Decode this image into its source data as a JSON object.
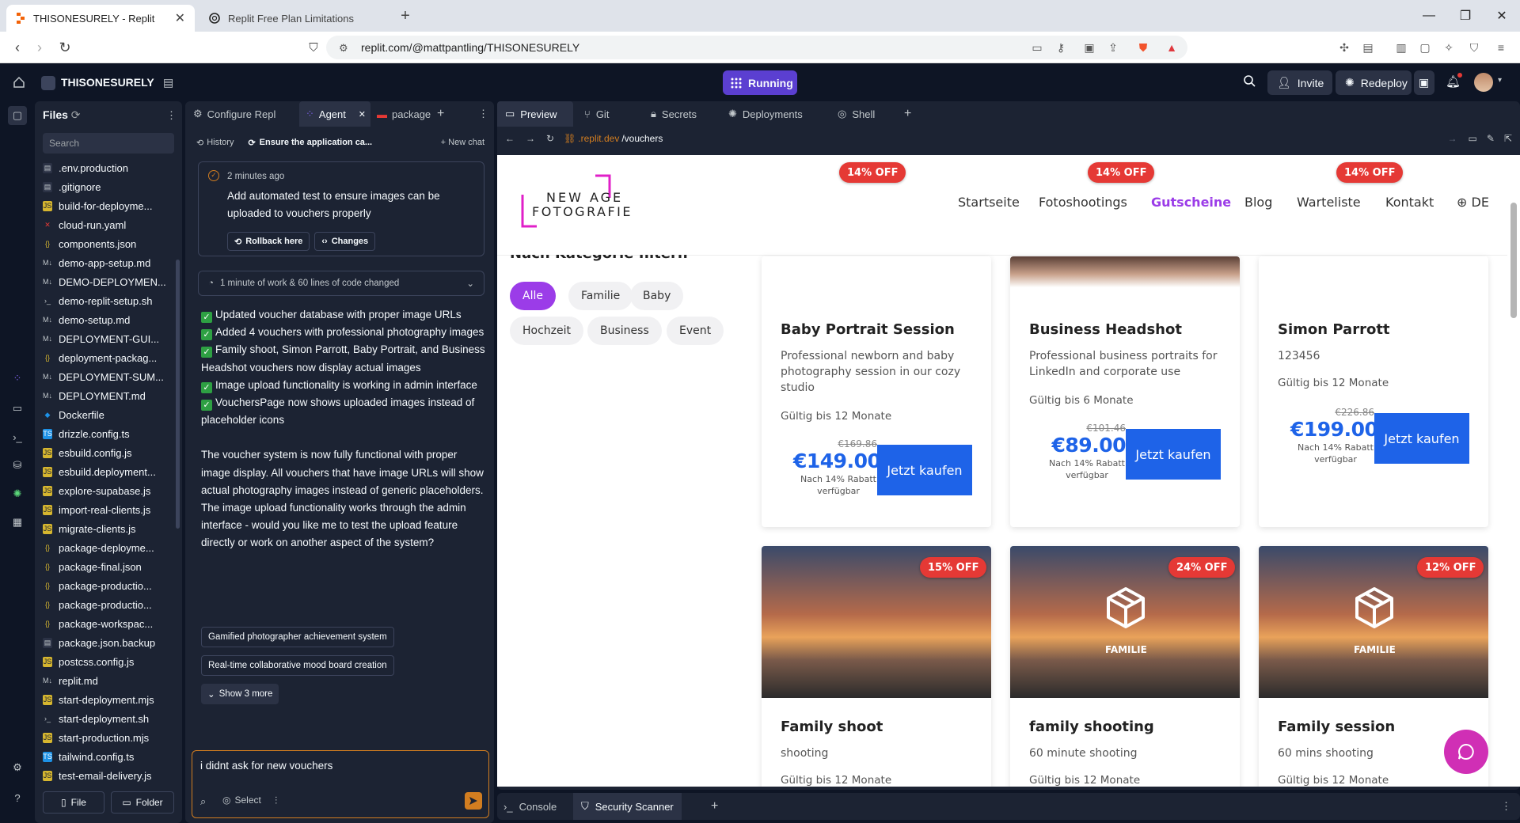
{
  "browser": {
    "tabs": [
      {
        "title": "THISONESURELY - Replit"
      },
      {
        "title": "Replit Free Plan Limitations"
      }
    ],
    "url": "replit.com/@mattpantling/THISONESURELY"
  },
  "header": {
    "project_name": "THISONESURELY",
    "status": "Running",
    "invite_label": "Invite",
    "redeploy_label": "Redeploy"
  },
  "files": {
    "title": "Files",
    "search_placeholder": "Search",
    "items": [
      {
        "name": ".env.production",
        "kind": "doc"
      },
      {
        "name": ".gitignore",
        "kind": "doc"
      },
      {
        "name": "build-for-deployme...",
        "kind": "js"
      },
      {
        "name": "cloud-run.yaml",
        "kind": "yaml"
      },
      {
        "name": "components.json",
        "kind": "json"
      },
      {
        "name": "demo-app-setup.md",
        "kind": "md"
      },
      {
        "name": "DEMO-DEPLOYMEN...",
        "kind": "md"
      },
      {
        "name": "demo-replit-setup.sh",
        "kind": "sh"
      },
      {
        "name": "demo-setup.md",
        "kind": "md"
      },
      {
        "name": "DEPLOYMENT-GUI...",
        "kind": "md"
      },
      {
        "name": "deployment-packag...",
        "kind": "json"
      },
      {
        "name": "DEPLOYMENT-SUM...",
        "kind": "md"
      },
      {
        "name": "DEPLOYMENT.md",
        "kind": "md"
      },
      {
        "name": "Dockerfile",
        "kind": "docker"
      },
      {
        "name": "drizzle.config.ts",
        "kind": "ts"
      },
      {
        "name": "esbuild.config.js",
        "kind": "js"
      },
      {
        "name": "esbuild.deployment...",
        "kind": "js"
      },
      {
        "name": "explore-supabase.js",
        "kind": "js"
      },
      {
        "name": "import-real-clients.js",
        "kind": "js"
      },
      {
        "name": "migrate-clients.js",
        "kind": "js"
      },
      {
        "name": "package-deployme...",
        "kind": "json"
      },
      {
        "name": "package-final.json",
        "kind": "json"
      },
      {
        "name": "package-productio...",
        "kind": "json"
      },
      {
        "name": "package-productio...",
        "kind": "json"
      },
      {
        "name": "package-workspac...",
        "kind": "json"
      },
      {
        "name": "package.json.backup",
        "kind": "doc"
      },
      {
        "name": "postcss.config.js",
        "kind": "js"
      },
      {
        "name": "replit.md",
        "kind": "md"
      },
      {
        "name": "start-deployment.mjs",
        "kind": "js"
      },
      {
        "name": "start-deployment.sh",
        "kind": "sh"
      },
      {
        "name": "start-production.mjs",
        "kind": "js"
      },
      {
        "name": "tailwind.config.ts",
        "kind": "ts"
      },
      {
        "name": "test-email-delivery.js",
        "kind": "js"
      }
    ],
    "new_file_label": "File",
    "new_folder_label": "Folder"
  },
  "agent_panel": {
    "tabs": [
      "Configure Repl",
      "Agent",
      "package"
    ],
    "history_label": "History",
    "thread_title": "Ensure the application ca...",
    "new_chat_label": "New chat",
    "checkpoint": {
      "time": "2 minutes ago",
      "text": "Add automated test to ensure images can be uploaded to vouchers properly",
      "rollback_label": "Rollback here",
      "changes_label": "Changes"
    },
    "work_summary": "1 minute of work & 60 lines of code changed",
    "checklist": [
      "Updated voucher database with proper image URLs",
      "Added 4 vouchers with professional photography images",
      "Family shoot, Simon Parrott, Baby Portrait, and Business Headshot vouchers now display actual images",
      "Image upload functionality is working in admin interface",
      "VouchersPage now shows uploaded images instead of placeholder icons"
    ],
    "message": "The voucher system is now fully functional with proper image display. All vouchers that have image URLs will show actual photography images instead of generic placeholders. The image upload functionality works through the admin interface - would you like me to test the upload feature directly or work on another aspect of the system?",
    "suggestions": [
      "Gamified photographer achievement system",
      "Real-time collaborative mood board creation"
    ],
    "show_more_label": "Show 3 more",
    "input_value": "i didnt ask for new vouchers",
    "select_label": "Select"
  },
  "preview_panel": {
    "tabs": [
      "Preview",
      "Git",
      "Secrets",
      "Deployments",
      "Shell"
    ],
    "url_domain": ".replit.dev",
    "url_path": "/vouchers"
  },
  "site": {
    "logo_line1": "NEW AGE",
    "logo_line2": "FOTOGRAFIE",
    "nav": [
      "Startseite",
      "Fotoshootings",
      "Gutscheine",
      "Blog",
      "Warteliste",
      "Kontakt",
      "DE"
    ],
    "filter_heading": "Nach Kategorie filtern",
    "filters": [
      "Alle",
      "Familie",
      "Baby",
      "Hochzeit",
      "Business",
      "Event"
    ],
    "top_badges": [
      "14% OFF",
      "14% OFF",
      "14% OFF"
    ],
    "vouchers_row1": [
      {
        "title": "Baby Portrait Session",
        "desc": "Professional newborn and baby photography session in our cozy studio",
        "valid": "Gültig bis 12 Monate",
        "old_price": "€169.86",
        "price": "€149.00",
        "note": "Nach 14% Rabatt verfügbar",
        "buy": "Jetzt kaufen"
      },
      {
        "title": "Business Headshot",
        "desc": "Professional business portraits for LinkedIn and corporate use",
        "valid": "Gültig bis 6 Monate",
        "old_price": "€101.46",
        "price": "€89.00",
        "note": "Nach 14% Rabatt verfügbar",
        "buy": "Jetzt kaufen"
      },
      {
        "title": "Simon Parrott",
        "desc": "123456",
        "valid": "Gültig bis 12 Monate",
        "old_price": "€226.86",
        "price": "€199.00",
        "note": "Nach 14% Rabatt verfügbar",
        "buy": "Jetzt kaufen"
      }
    ],
    "vouchers_row2": [
      {
        "title": "Family shoot",
        "desc": "shooting",
        "valid": "Gültig bis 12 Monate",
        "badge": "15% OFF",
        "tag": ""
      },
      {
        "title": "family shooting",
        "desc": "60 minute shooting",
        "valid": "Gültig bis 12 Monate",
        "badge": "24% OFF",
        "tag": "FAMILIE"
      },
      {
        "title": "Family session",
        "desc": "60 mins shooting",
        "valid": "Gültig bis 12 Monate",
        "badge": "12% OFF",
        "tag": "FAMILIE"
      }
    ]
  },
  "bottom_panel": {
    "tabs": [
      "Console",
      "Security Scanner"
    ]
  },
  "colors": {
    "accent_purple": "#5b3fd1",
    "price_blue": "#1e63e8",
    "badge_red": "#e53935",
    "nav_active": "#9b3ce8",
    "chat_fab": "#d02fb5"
  }
}
